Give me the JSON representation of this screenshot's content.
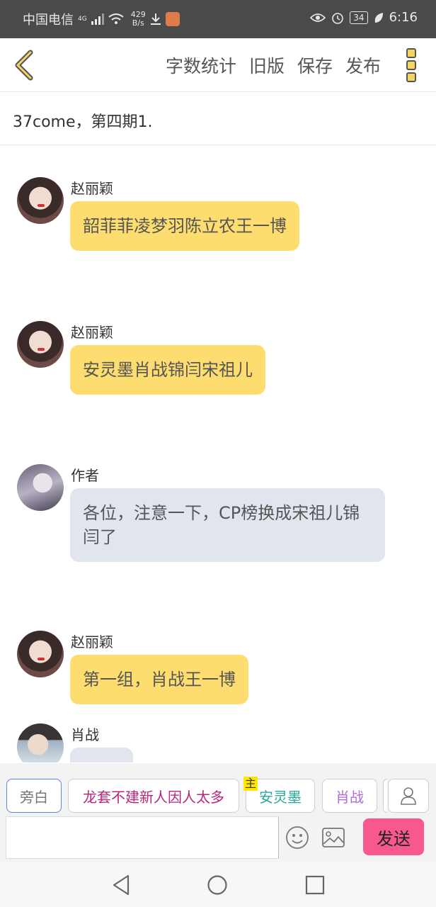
{
  "status_bar": {
    "carrier": "中国电信",
    "network_badge": "4G",
    "speed_value": "429",
    "speed_unit": "B/s",
    "battery": "34",
    "time": "6:16"
  },
  "toolbar": {
    "word_count": "字数统计",
    "old_version": "旧版",
    "save": "保存",
    "publish": "发布"
  },
  "title": "37come，第四期1.",
  "messages": [
    {
      "name": "赵丽颖",
      "text": "韶菲菲凌梦羽陈立农王一博",
      "style": "yellow",
      "avatar": "zhao"
    },
    {
      "name": "赵丽颖",
      "text": "安灵墨肖战锦闫宋祖儿",
      "style": "yellow",
      "avatar": "zhao"
    },
    {
      "name": "作者",
      "text": "各位，注意一下，CP榜换成宋祖儿锦闫了",
      "style": "gray",
      "avatar": "author"
    },
    {
      "name": "赵丽颖",
      "text": "第一组，肖战王一博",
      "style": "yellow",
      "avatar": "zhao"
    },
    {
      "name": "肖战",
      "text": "",
      "style": "gray",
      "avatar": "xiao"
    }
  ],
  "roles": {
    "narration": "旁白",
    "role1": "龙套不建新人因人太多",
    "main_tag": "主",
    "role2": "安灵墨",
    "role3": "肖战"
  },
  "input": {
    "value": "",
    "send": "发送"
  },
  "colors": {
    "bubble_yellow": "#fddd70",
    "bubble_gray": "#e1e6ee",
    "send_button": "#f6588f"
  }
}
